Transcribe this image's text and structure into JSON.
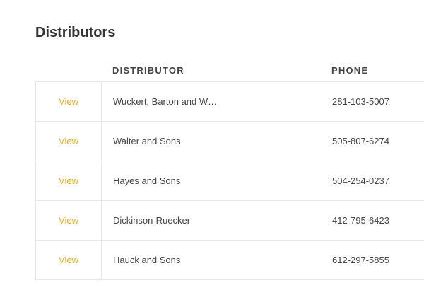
{
  "page": {
    "title": "Distributors"
  },
  "table": {
    "headers": {
      "distributor": "DISTRIBUTOR",
      "phone": "PHONE"
    },
    "rows": [
      {
        "action": "View",
        "distributor": "Wuckert, Barton and W…",
        "phone": "281-103-5007"
      },
      {
        "action": "View",
        "distributor": "Walter and Sons",
        "phone": "505-807-6274"
      },
      {
        "action": "View",
        "distributor": "Hayes and Sons",
        "phone": "504-254-0237"
      },
      {
        "action": "View",
        "distributor": "Dickinson-Ruecker",
        "phone": "412-795-6423"
      },
      {
        "action": "View",
        "distributor": "Hauck and Sons",
        "phone": "612-297-5855"
      }
    ]
  },
  "colors": {
    "accent": "#f0a81a",
    "text": "#444444",
    "border": "#e6e6e6"
  }
}
